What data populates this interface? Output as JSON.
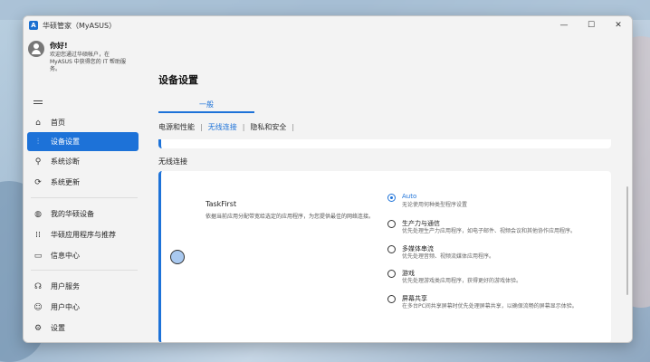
{
  "window": {
    "logo_text": "A",
    "title": "华硕管家（MyASUS）",
    "controls": {
      "minimize": "—",
      "maximize": "☐",
      "close": "✕"
    }
  },
  "profile": {
    "greeting": "你好!",
    "description": "欢迎您通过华硕帐户，在 MyASUS 中获得您的 IT 帮助服务。"
  },
  "sidebar": {
    "items": [
      {
        "label": "首页",
        "icon": "home-icon"
      },
      {
        "label": "设备设置",
        "icon": "settings-sliders-icon",
        "active": true
      },
      {
        "label": "系统诊断",
        "icon": "diagnose-icon"
      },
      {
        "label": "系统更新",
        "icon": "update-icon"
      },
      {
        "label": "我的华硕设备",
        "icon": "devices-icon"
      },
      {
        "label": "华硕应用程序与推荐",
        "icon": "apps-icon"
      },
      {
        "label": "信息中心",
        "icon": "message-icon"
      },
      {
        "label": "用户服务",
        "icon": "headset-icon"
      },
      {
        "label": "用户中心",
        "icon": "user-icon"
      },
      {
        "label": "设置",
        "icon": "gear-icon"
      }
    ]
  },
  "main": {
    "page_title": "设备设置",
    "tab_general": "一般",
    "subtabs": [
      "电源和性能",
      "无线连接",
      "隐私和安全"
    ],
    "subtab_separator": "|",
    "section_label": "无线连接",
    "card": {
      "title": "TaskFirst",
      "description": "依据当前应用分配带宽给选定的应用程序，为您提供最佳的网络连接。",
      "options": [
        {
          "title": "Auto",
          "desc": "无论使用何种类型程序设置",
          "selected": true
        },
        {
          "title": "生产力与通信",
          "desc": "优先处理生产力应用程序，如电子邮件、视频会议和其他协作应用程序。"
        },
        {
          "title": "多媒体串流",
          "desc": "优先处理音频、视频流媒体应用程序。"
        },
        {
          "title": "游戏",
          "desc": "优先处理游戏类应用程序，获得更好的游戏体验。"
        },
        {
          "title": "屏幕共享",
          "desc": "在多台PC间共享屏幕时优先处理屏幕共享，以确保流畅的屏幕显示体验。"
        }
      ]
    }
  }
}
